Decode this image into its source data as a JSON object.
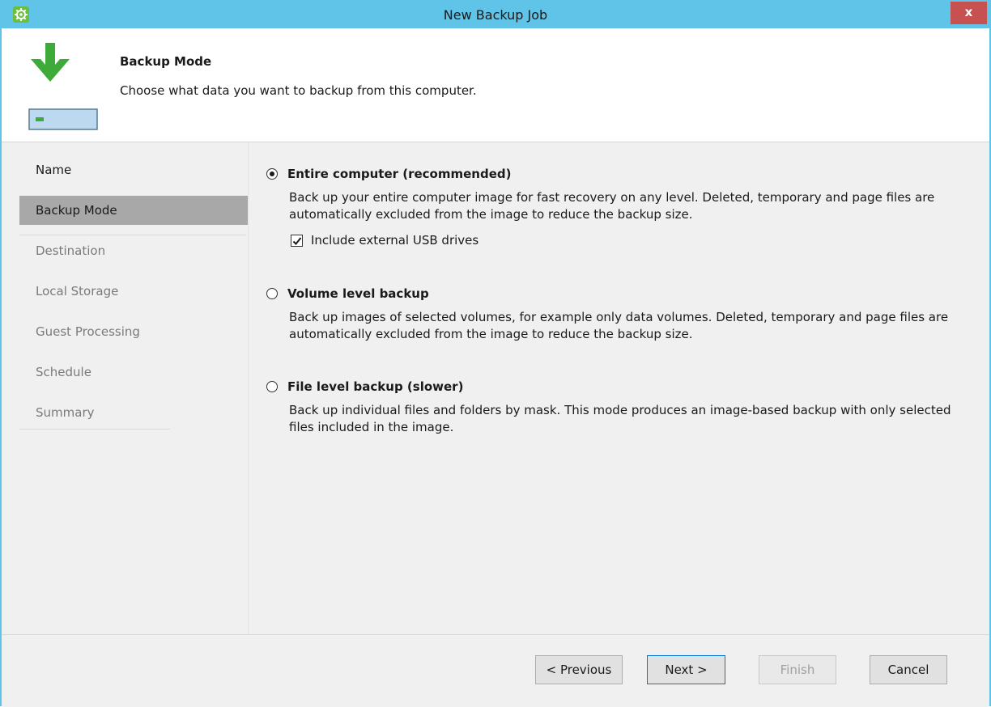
{
  "window": {
    "title": "New Backup Job",
    "close_label": "x",
    "titlebar_color": "#5fc4e8",
    "app_icon": "gear-icon"
  },
  "header": {
    "icon": "download-to-drive-icon",
    "title": "Backup Mode",
    "description": "Choose what data you want to backup from this computer."
  },
  "sidebar": {
    "items": [
      {
        "label": "Name",
        "state": "normal"
      },
      {
        "label": "Backup Mode",
        "state": "selected"
      },
      {
        "label": "Destination",
        "state": "disabled"
      },
      {
        "label": "Local Storage",
        "state": "disabled"
      },
      {
        "label": "Guest Processing",
        "state": "disabled"
      },
      {
        "label": "Schedule",
        "state": "disabled"
      },
      {
        "label": "Summary",
        "state": "disabled"
      }
    ]
  },
  "options": [
    {
      "label": "Entire computer (recommended)",
      "selected": true,
      "description": "Back up your entire computer image for fast recovery on any level. Deleted, temporary and page files are automatically excluded from the image to reduce the backup size.",
      "checkbox": {
        "label": "Include external USB drives",
        "checked": true
      }
    },
    {
      "label": "Volume level backup",
      "selected": false,
      "description": "Back up images of selected volumes, for example only data volumes. Deleted, temporary and page files are automatically excluded from the image to reduce the backup size."
    },
    {
      "label": "File level backup (slower)",
      "selected": false,
      "description": "Back up individual files and folders by mask. This mode produces an image-based backup with only selected files included in the image."
    }
  ],
  "footer": {
    "previous_label": "< Previous",
    "next_label": "Next >",
    "finish_label": "Finish",
    "cancel_label": "Cancel"
  }
}
